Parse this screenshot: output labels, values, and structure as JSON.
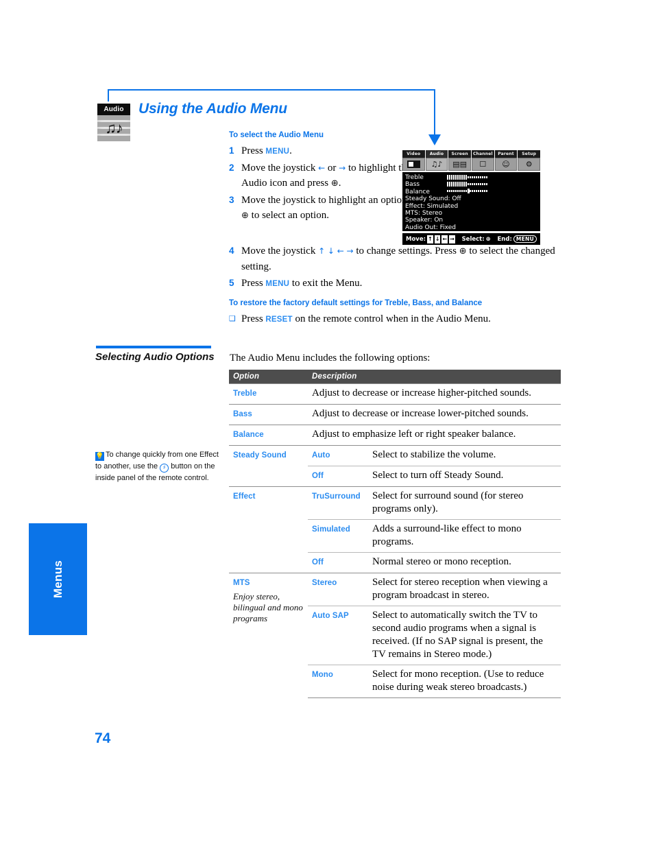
{
  "doc": {
    "page_number": "74",
    "side_tab_label": "Menus",
    "title": "Using the Audio Menu",
    "badge_label": "Audio"
  },
  "instructions": {
    "heading": "To select the Audio Menu",
    "steps": [
      {
        "num": "1",
        "text_a": "Press ",
        "kw": "MENU",
        "text_b": "."
      },
      {
        "num": "2",
        "text_a": "Move the joystick ",
        "glyph_a": "←",
        "mid": " or ",
        "glyph_b": "→",
        "text_b": " to highlight the Audio icon and press ",
        "sel_glyph": "⊕",
        "text_c": "."
      },
      {
        "num": "3",
        "text_a": "Move the joystick to highlight an option. Press ",
        "sel_glyph": "⊕",
        "text_b": " to select an option."
      },
      {
        "num": "4",
        "text_a": "Move the joystick ",
        "glyph_a": "↑",
        "glyph_b": "↓",
        "glyph_c": "←",
        "glyph_d": "→",
        "text_b": " to change settings. Press ",
        "sel_glyph": "⊕",
        "text_c": " to select the changed setting."
      },
      {
        "num": "5",
        "text_a": "Press ",
        "kw": "MENU",
        "text_b": " to exit the Menu."
      }
    ]
  },
  "restore": {
    "heading": "To restore the factory default settings for Treble, Bass, and Balance",
    "bullet_glyph": "❑",
    "text_a": "Press ",
    "kw": "RESET",
    "text_b": " on the remote control when in the Audio Menu."
  },
  "osd": {
    "tabs": [
      {
        "label": "Video",
        "icon": "video-icon",
        "active": false
      },
      {
        "label": "Audio",
        "icon": "audio-icon",
        "active": true
      },
      {
        "label": "Screen",
        "icon": "screen-icon",
        "active": false
      },
      {
        "label": "Channel",
        "icon": "channel-icon",
        "active": false
      },
      {
        "label": "Parent",
        "icon": "parent-icon",
        "active": false
      },
      {
        "label": "Setup",
        "icon": "setup-icon",
        "active": false
      }
    ],
    "lines": [
      {
        "label": "Treble",
        "bar": "level"
      },
      {
        "label": "Bass",
        "bar": "level"
      },
      {
        "label": "Balance",
        "bar": "balance"
      },
      {
        "label": "Steady Sound: Off"
      },
      {
        "label": "Effect: Simulated"
      },
      {
        "label": "MTS: Stereo"
      },
      {
        "label": "Speaker: On"
      },
      {
        "label": "Audio Out: Fixed"
      }
    ],
    "footer": {
      "move_label": "Move:",
      "move_keys": [
        "↑",
        "↓",
        "←",
        "→"
      ],
      "select_label": "Select:",
      "select_glyph": "⊕",
      "end_label": "End:",
      "end_key": "MENU"
    }
  },
  "sidebar": {
    "heading": "Selecting Audio Options",
    "tip": {
      "bulb_icon": "lightbulb-icon",
      "text_a": "To change quickly from one Effect to another, use the ",
      "button_icon": "effect-button-icon",
      "text_b": " button on the inside panel of the remote control."
    }
  },
  "table": {
    "intro": "The Audio Menu includes the following options:",
    "headers": [
      "Option",
      "Description"
    ],
    "rows": [
      {
        "group_start": true,
        "option": "Treble",
        "option_sub": "",
        "value": "",
        "desc": "Adjust to decrease or increase higher-pitched sounds.",
        "span": true
      },
      {
        "group_start": true,
        "option": "Bass",
        "option_sub": "",
        "value": "",
        "desc": "Adjust to decrease or increase lower-pitched sounds.",
        "span": true
      },
      {
        "group_start": true,
        "option": "Balance",
        "option_sub": "",
        "value": "",
        "desc": "Adjust to emphasize left or right speaker balance.",
        "span": true
      },
      {
        "group_start": true,
        "option": "Steady Sound",
        "option_sub": "",
        "value": "Auto",
        "desc": "Select to stabilize the volume.",
        "span": false
      },
      {
        "group_start": false,
        "option": "",
        "option_sub": "",
        "value": "Off",
        "desc": "Select to turn off Steady Sound.",
        "span": false
      },
      {
        "group_start": true,
        "option": "Effect",
        "option_sub": "",
        "value": "TruSurround",
        "desc": "Select for surround sound (for stereo programs only).",
        "span": false
      },
      {
        "group_start": false,
        "option": "",
        "option_sub": "",
        "value": "Simulated",
        "desc": "Adds a surround-like effect to mono programs.",
        "span": false
      },
      {
        "group_start": false,
        "option": "",
        "option_sub": "",
        "value": "Off",
        "desc": "Normal stereo or mono reception.",
        "span": false
      },
      {
        "group_start": true,
        "option": "MTS",
        "option_sub": "Enjoy stereo, bilingual and mono programs",
        "value": "Stereo",
        "desc": "Select for stereo reception when viewing a program broadcast in stereo.",
        "span": false
      },
      {
        "group_start": false,
        "option": "",
        "option_sub": "",
        "value": "Auto SAP",
        "desc": "Select to automatically switch the TV to second audio programs when a signal is received. (If no SAP signal is present, the TV remains in Stereo mode.)",
        "span": false
      },
      {
        "group_start": false,
        "option": "",
        "option_sub": "",
        "value": "Mono",
        "desc": "Select for mono reception. (Use to reduce noise during weak stereo broadcasts.)",
        "span": false
      }
    ]
  },
  "colors": {
    "accent_blue": "#0b74e8",
    "link_blue": "#2b8cf0",
    "table_header_bg": "#4d4d4d",
    "osd_bg": "#000000"
  }
}
